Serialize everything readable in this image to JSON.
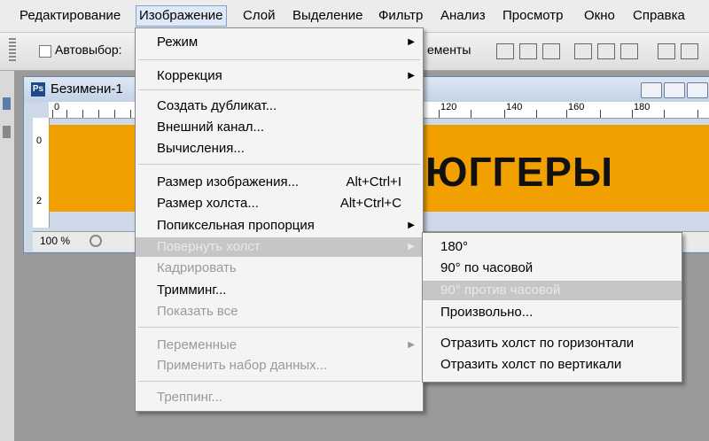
{
  "menubar": {
    "items": [
      "Редактирование",
      "Изображение",
      "Слой",
      "Выделение",
      "Фильтр",
      "Анализ",
      "Просмотр",
      "Окно",
      "Справка"
    ]
  },
  "options_bar": {
    "autoselect_label": "Автовыбор:",
    "partial_right": "ементы"
  },
  "document": {
    "title": "Безимени-1",
    "ps_icon_text": "Ps",
    "ruler_numbers": [
      "0",
      "120",
      "140",
      "160",
      "180"
    ],
    "ruler_left_numbers": [
      "0",
      "2"
    ],
    "canvas_text": "ЮГГЕРЫ",
    "canvas_color": "#f2a000",
    "zoom": "100 %"
  },
  "image_menu": {
    "items": [
      {
        "label": "Режим",
        "shortcut": "",
        "submenu": true,
        "disabled": false
      },
      {
        "label": "Коррекция",
        "shortcut": "",
        "submenu": true,
        "disabled": false
      },
      {
        "label": "Создать дубликат...",
        "shortcut": "",
        "submenu": false,
        "disabled": false
      },
      {
        "label": "Внешний канал...",
        "shortcut": "",
        "submenu": false,
        "disabled": false
      },
      {
        "label": "Вычисления...",
        "shortcut": "",
        "submenu": false,
        "disabled": false
      },
      {
        "label": "Размер изображения...",
        "shortcut": "Alt+Ctrl+I",
        "submenu": false,
        "disabled": false
      },
      {
        "label": "Размер холста...",
        "shortcut": "Alt+Ctrl+C",
        "submenu": false,
        "disabled": false
      },
      {
        "label": "Попиксельная пропорция",
        "shortcut": "",
        "submenu": true,
        "disabled": false
      },
      {
        "label": "Повернуть холст",
        "shortcut": "",
        "submenu": true,
        "disabled": false,
        "highlighted": true
      },
      {
        "label": "Кадрировать",
        "shortcut": "",
        "submenu": false,
        "disabled": true
      },
      {
        "label": "Тримминг...",
        "shortcut": "",
        "submenu": false,
        "disabled": false
      },
      {
        "label": "Показать все",
        "shortcut": "",
        "submenu": false,
        "disabled": true
      },
      {
        "label": "Переменные",
        "shortcut": "",
        "submenu": true,
        "disabled": true
      },
      {
        "label": "Применить набор данных...",
        "shortcut": "",
        "submenu": false,
        "disabled": true
      },
      {
        "label": "Треппинг...",
        "shortcut": "",
        "submenu": false,
        "disabled": true
      }
    ]
  },
  "rotate_submenu": {
    "items": [
      {
        "label": "180°",
        "highlighted": false
      },
      {
        "label": "90° по часовой",
        "highlighted": false
      },
      {
        "label": "90° против часовой",
        "highlighted": true
      },
      {
        "label": "Произвольно...",
        "highlighted": false
      },
      {
        "label": "Отразить холст по горизонтали",
        "highlighted": false
      },
      {
        "label": "Отразить холст по вертикали",
        "highlighted": false
      }
    ]
  },
  "icons": {
    "submenu_arrow": "▶",
    "checkbox": "checkbox-icon",
    "align_icons": [
      "align-top-icon",
      "align-middle-icon",
      "align-bottom-icon",
      "align-left-icon",
      "align-center-icon",
      "align-right-icon",
      "distribute-icon"
    ]
  }
}
